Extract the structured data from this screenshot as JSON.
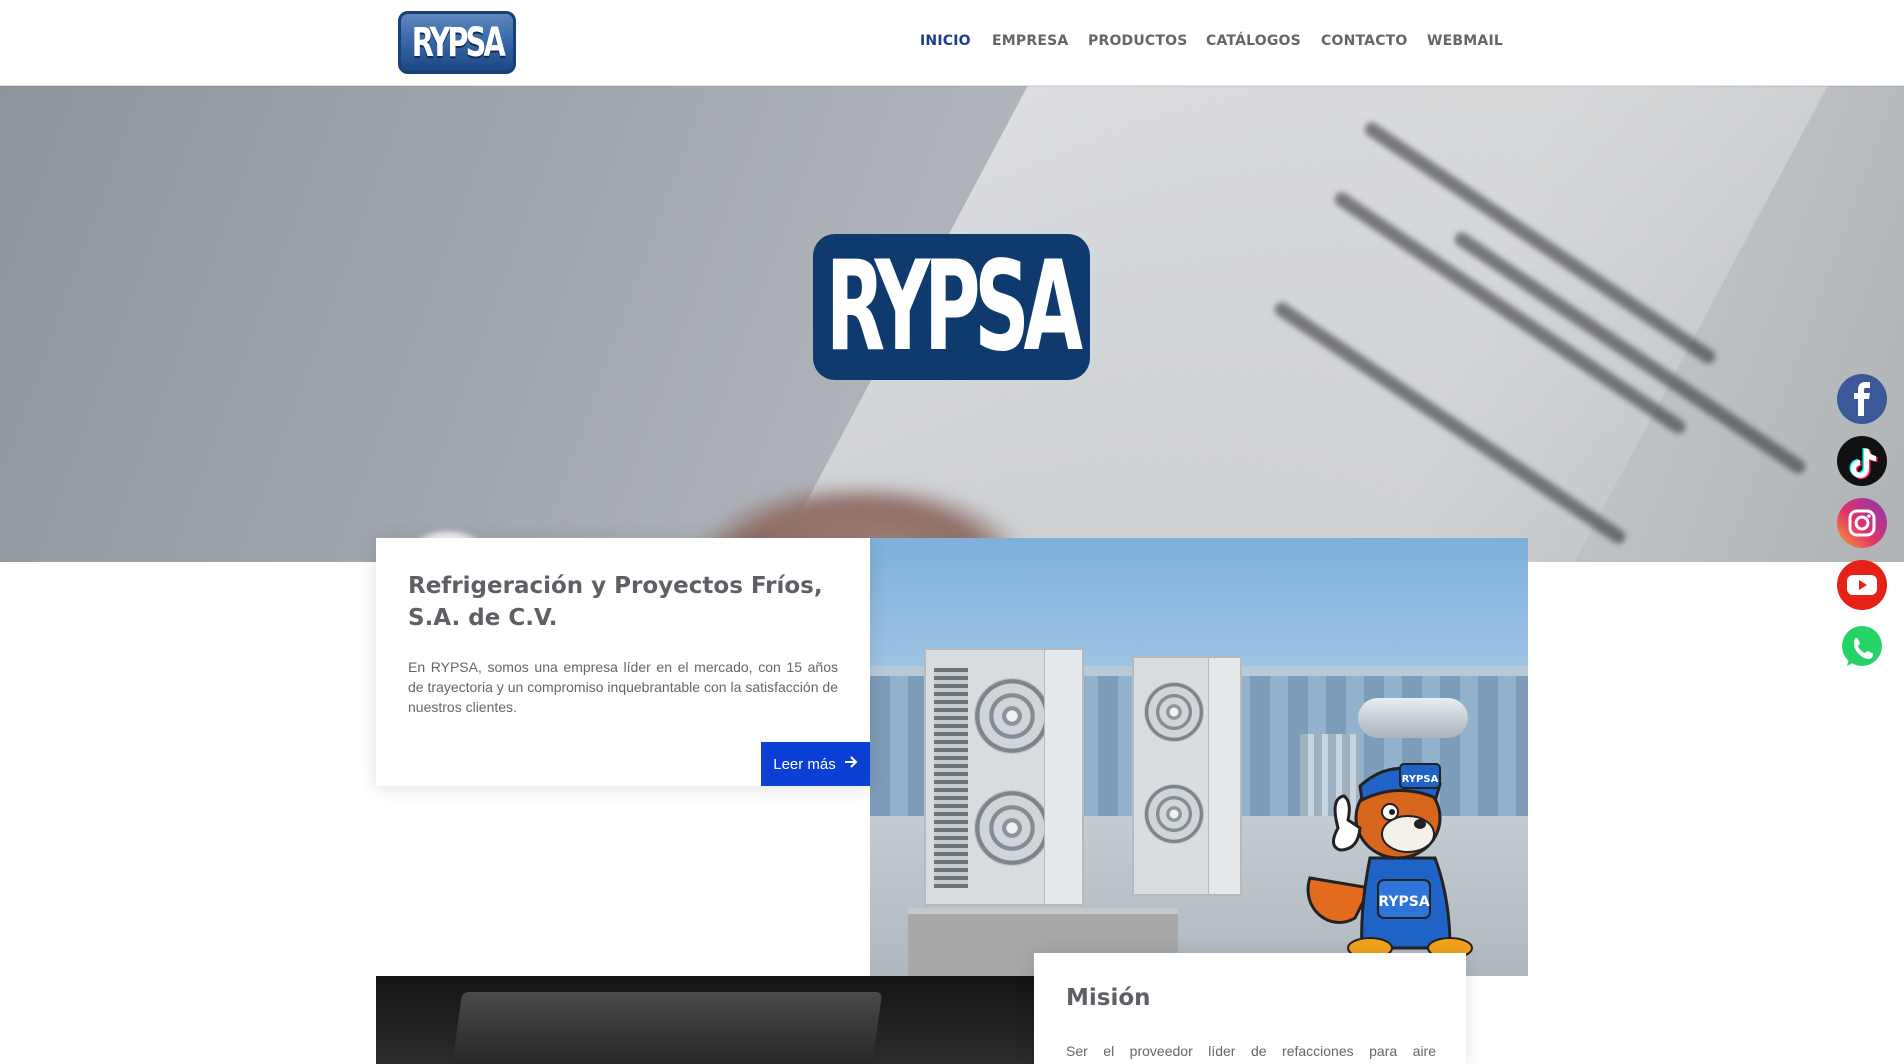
{
  "header": {
    "logo_text": "RYPSA",
    "nav": [
      {
        "label": "INICIO",
        "active": true
      },
      {
        "label": "EMPRESA",
        "active": false
      },
      {
        "label": "PRODUCTOS",
        "active": false
      },
      {
        "label": "CATÁLOGOS",
        "active": false
      },
      {
        "label": "CONTACTO",
        "active": false
      },
      {
        "label": "WEBMAIL",
        "active": false
      }
    ]
  },
  "hero": {
    "logo_text": "RYPSA"
  },
  "social": [
    {
      "name": "facebook-icon",
      "color": "#3b5998"
    },
    {
      "name": "tiktok-icon",
      "color": "#000000"
    },
    {
      "name": "instagram-icon",
      "color": "#e1306c"
    },
    {
      "name": "youtube-icon",
      "color": "#e62117"
    },
    {
      "name": "whatsapp-icon",
      "color": "#25d366"
    }
  ],
  "intro": {
    "title": "Refrigeración y Proyectos Fríos, S.A. de C.V.",
    "body": "En RYPSA, somos una empresa líder en el mercado, con 15 años de trayectoria y un compromiso inquebrantable con la satisfacción de nuestros clientes.",
    "button_label": "Leer más",
    "button_icon": "arrow-right-icon"
  },
  "mascot": {
    "cap_text": "RYPSA",
    "shirt_text": "RYPSA"
  },
  "mision": {
    "title": "Misión",
    "body": "Ser el proveedor líder de refacciones para aire"
  },
  "colors": {
    "nav_active": "#1c3e8a",
    "button": "#0c3fd6",
    "brand_navy": "#0e3a6e"
  }
}
